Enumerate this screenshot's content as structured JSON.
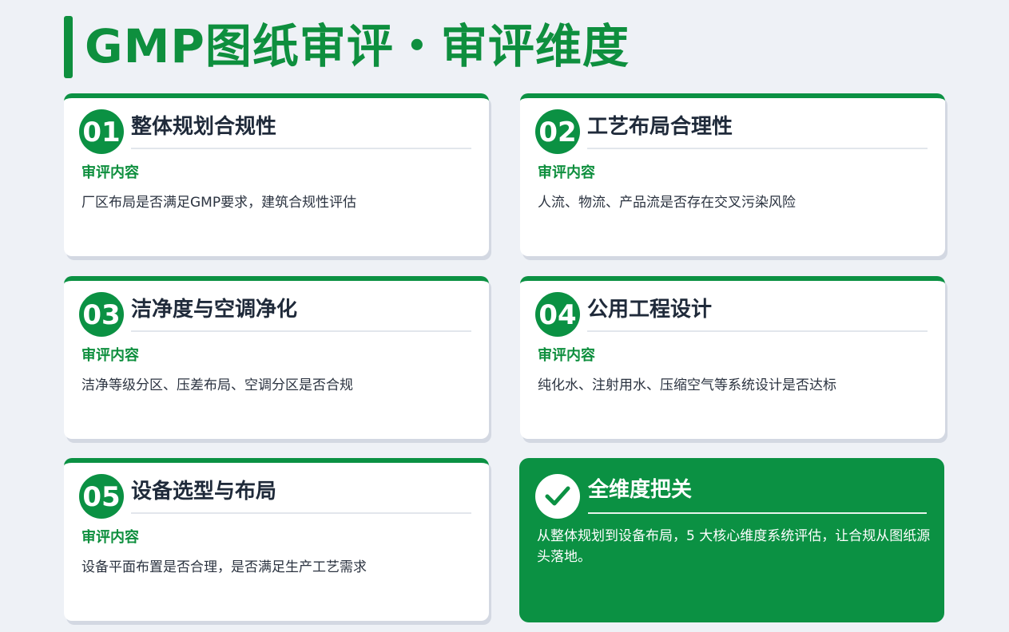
{
  "header": {
    "title": "GMP图纸审评・审评维度"
  },
  "cards": [
    {
      "num": "01",
      "title": "整体规划合规性",
      "label": "审评内容",
      "desc": "厂区布局是否满足GMP要求，建筑合规性评估"
    },
    {
      "num": "02",
      "title": "工艺布局合理性",
      "label": "审评内容",
      "desc": "人流、物流、产品流是否存在交叉污染风险"
    },
    {
      "num": "03",
      "title": "洁净度与空调净化",
      "label": "审评内容",
      "desc": "洁净等级分区、压差布局、空调分区是否合规"
    },
    {
      "num": "04",
      "title": "公用工程设计",
      "label": "审评内容",
      "desc": "纯化水、注射用水、压缩空气等系统设计是否达标"
    },
    {
      "num": "05",
      "title": "设备选型与布局",
      "label": "审评内容",
      "desc": "设备平面布置是否合理，是否满足生产工艺需求"
    }
  ],
  "summary": {
    "icon": "check-icon",
    "title": "全维度把关",
    "desc": "从整体规划到设备布局，5 大核心维度系统评估，让合规从图纸源头落地。"
  },
  "colors": {
    "accent": "#0b9143",
    "title_text": "#1f2a3a",
    "background": "#eef1f6"
  }
}
